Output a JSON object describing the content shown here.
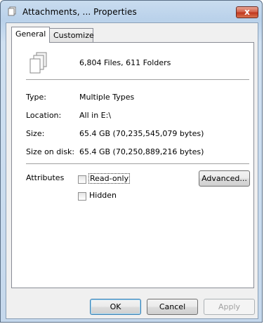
{
  "window": {
    "title": "Attachments, ... Properties",
    "close_glyph": "x"
  },
  "tabs": [
    {
      "label": "General",
      "active": true
    },
    {
      "label": "Customize",
      "active": false
    }
  ],
  "summary": {
    "contents": "6,804 Files, 611 Folders"
  },
  "details": {
    "type_label": "Type:",
    "type_value": "Multiple Types",
    "location_label": "Location:",
    "location_value": "All in E:\\",
    "size_label": "Size:",
    "size_value": "65.4 GB (70,235,545,079 bytes)",
    "size_on_disk_label": "Size on disk:",
    "size_on_disk_value": "65.4 GB (70,250,889,216 bytes)"
  },
  "attributes": {
    "label": "Attributes",
    "readonly_label": "Read-only",
    "readonly_checked": false,
    "hidden_label": "Hidden",
    "hidden_checked": false,
    "advanced_label": "Advanced..."
  },
  "footer": {
    "ok_label": "OK",
    "cancel_label": "Cancel",
    "apply_label": "Apply"
  },
  "colors": {
    "close_button": "#c1381f",
    "default_button_border": "#3c7fb1"
  }
}
